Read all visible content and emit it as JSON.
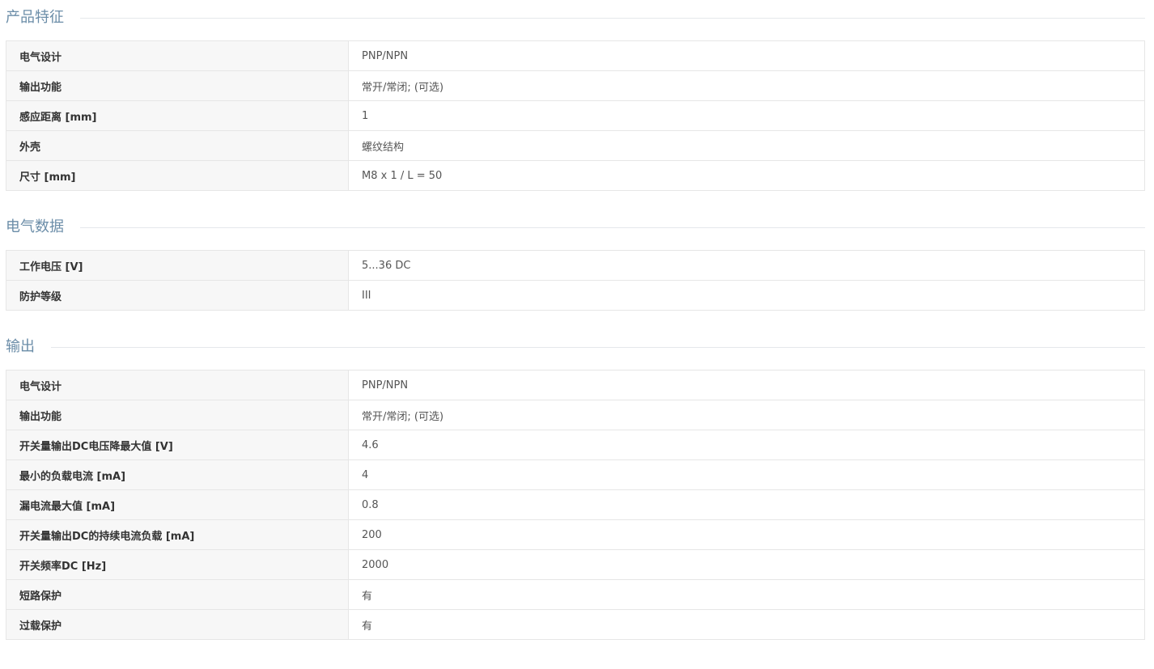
{
  "sections": [
    {
      "title": "产品特征",
      "rows": [
        {
          "label": "电气设计",
          "value": "PNP/NPN"
        },
        {
          "label": "输出功能",
          "value": "常开/常闭; (可选)"
        },
        {
          "label": "感应距离 [mm]",
          "value": "1"
        },
        {
          "label": "外壳",
          "value": "螺纹结构"
        },
        {
          "label": "尺寸 [mm]",
          "value": "M8 x 1 / L = 50"
        }
      ]
    },
    {
      "title": "电气数据",
      "rows": [
        {
          "label": "工作电压 [V]",
          "value": "5...36 DC"
        },
        {
          "label": "防护等级",
          "value": "III"
        }
      ]
    },
    {
      "title": "输出",
      "rows": [
        {
          "label": "电气设计",
          "value": "PNP/NPN"
        },
        {
          "label": "输出功能",
          "value": "常开/常闭; (可选)"
        },
        {
          "label": "开关量输出DC电压降最大值 [V]",
          "value": "4.6"
        },
        {
          "label": "最小的负载电流 [mA]",
          "value": "4"
        },
        {
          "label": "漏电流最大值 [mA]",
          "value": "0.8"
        },
        {
          "label": "开关量输出DC的持续电流负载 [mA]",
          "value": "200"
        },
        {
          "label": "开关频率DC [Hz]",
          "value": "2000"
        },
        {
          "label": "短路保护",
          "value": "有"
        },
        {
          "label": "过载保护",
          "value": "有"
        }
      ]
    }
  ],
  "colors": {
    "section_title": "#6b8da8",
    "label_bg": "#f7f7f7",
    "border": "#e6e6e6"
  }
}
